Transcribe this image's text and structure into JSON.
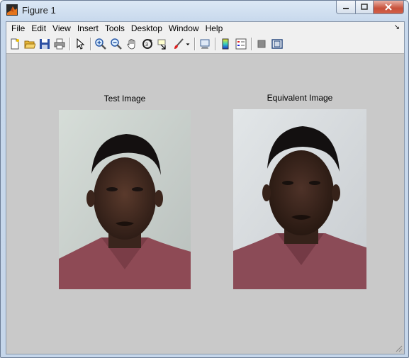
{
  "window": {
    "title": "Figure 1"
  },
  "menu": [
    "File",
    "Edit",
    "View",
    "Insert",
    "Tools",
    "Desktop",
    "Window",
    "Help"
  ],
  "toolbar": {
    "icons": [
      "new-figure-icon",
      "open-file-icon",
      "save-icon",
      "print-icon",
      "pointer-icon",
      "zoom-in-icon",
      "zoom-out-icon",
      "pan-hand-icon",
      "rotate-3d-icon",
      "data-cursor-icon",
      "brush-icon",
      "dropdown-arrow-icon",
      "link-plot-icon",
      "colorbar-icon",
      "legend-icon",
      "hide-plot-tools-icon",
      "show-plot-tools-icon"
    ]
  },
  "axes": [
    {
      "title": "Test Image"
    },
    {
      "title": "Equivalent Image"
    }
  ]
}
